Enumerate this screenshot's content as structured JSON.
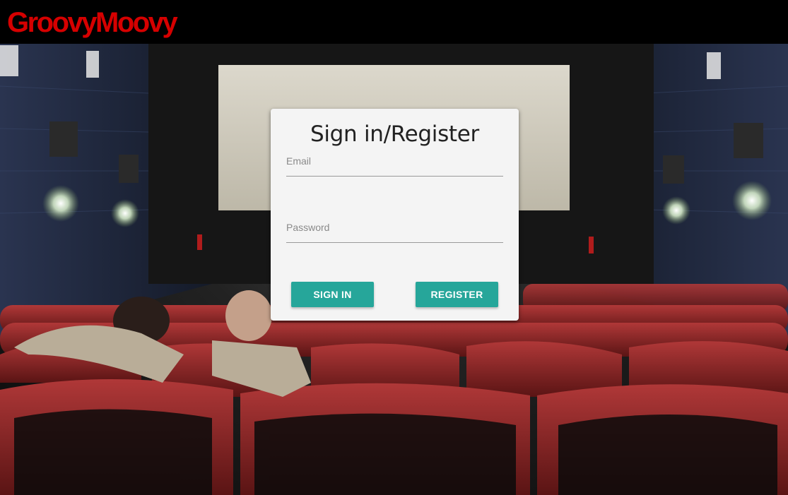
{
  "header": {
    "brand": "GroovyMoovy"
  },
  "background": {
    "description_icon": "cinema-theater-image"
  },
  "login": {
    "title": "Sign in/Register",
    "email": {
      "placeholder": "Email",
      "value": ""
    },
    "password": {
      "placeholder": "Password",
      "value": ""
    },
    "signin_label": "SIGN IN",
    "register_label": "REGISTER"
  },
  "colors": {
    "brand": "#d60000",
    "button": "#26a69a",
    "card": "#f4f4f4",
    "seat": "#8b2020"
  }
}
